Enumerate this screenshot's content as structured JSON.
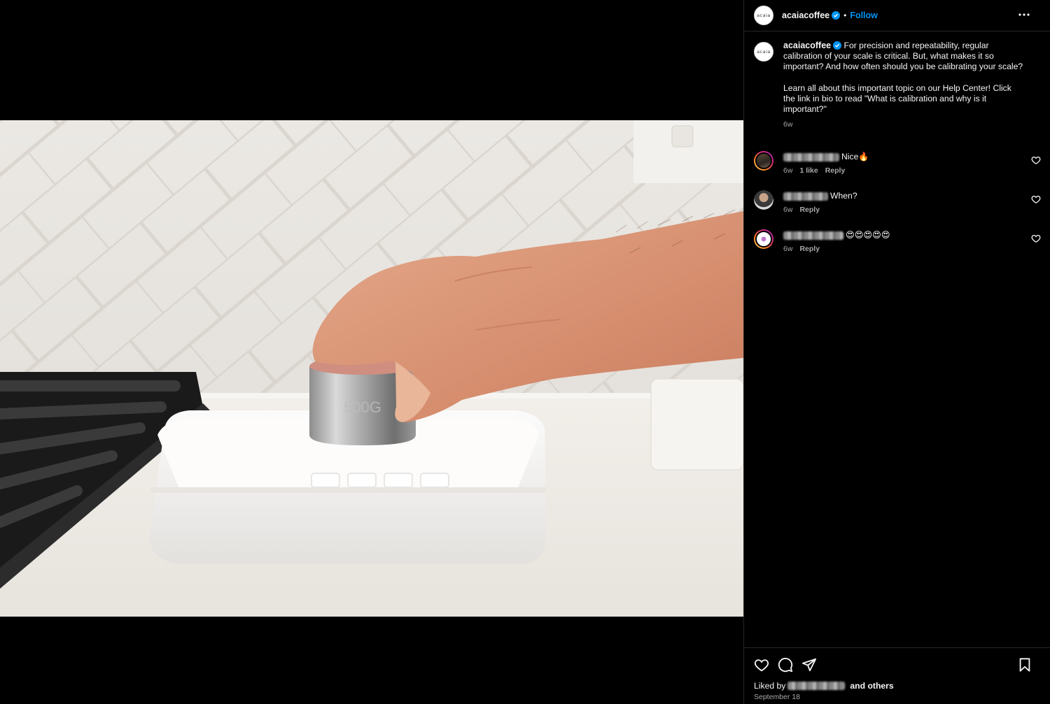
{
  "post": {
    "username": "acaiacoffee",
    "follow_label": "Follow",
    "dot": "•",
    "avatar_text": "acaia",
    "photo_alt_icon": "weight-on-scale-photo",
    "weight_engraving": "500G",
    "caption": "For precision and repeatability, regular calibration of your scale is critical. But, what makes it so important? And how often should you be calibrating your scale?\n\nLearn all about this important topic on our Help Center! Click the link in bio to read \"What is calibration and why is it important?\"",
    "caption_time": "6w"
  },
  "comments": [
    {
      "text": "Nice🔥",
      "time": "6w",
      "likes": "1 like",
      "reply": "Reply"
    },
    {
      "text": "When?",
      "time": "6w",
      "reply": "Reply"
    },
    {
      "text": "😍😍😍😍😍",
      "time": "6w",
      "reply": "Reply"
    }
  ],
  "footer": {
    "liked_by_prefix": "Liked by",
    "and_others": "and others",
    "date": "September 18"
  },
  "colors": {
    "accent": "#0095f6",
    "muted": "#a8a8a8",
    "background": "#000000"
  }
}
